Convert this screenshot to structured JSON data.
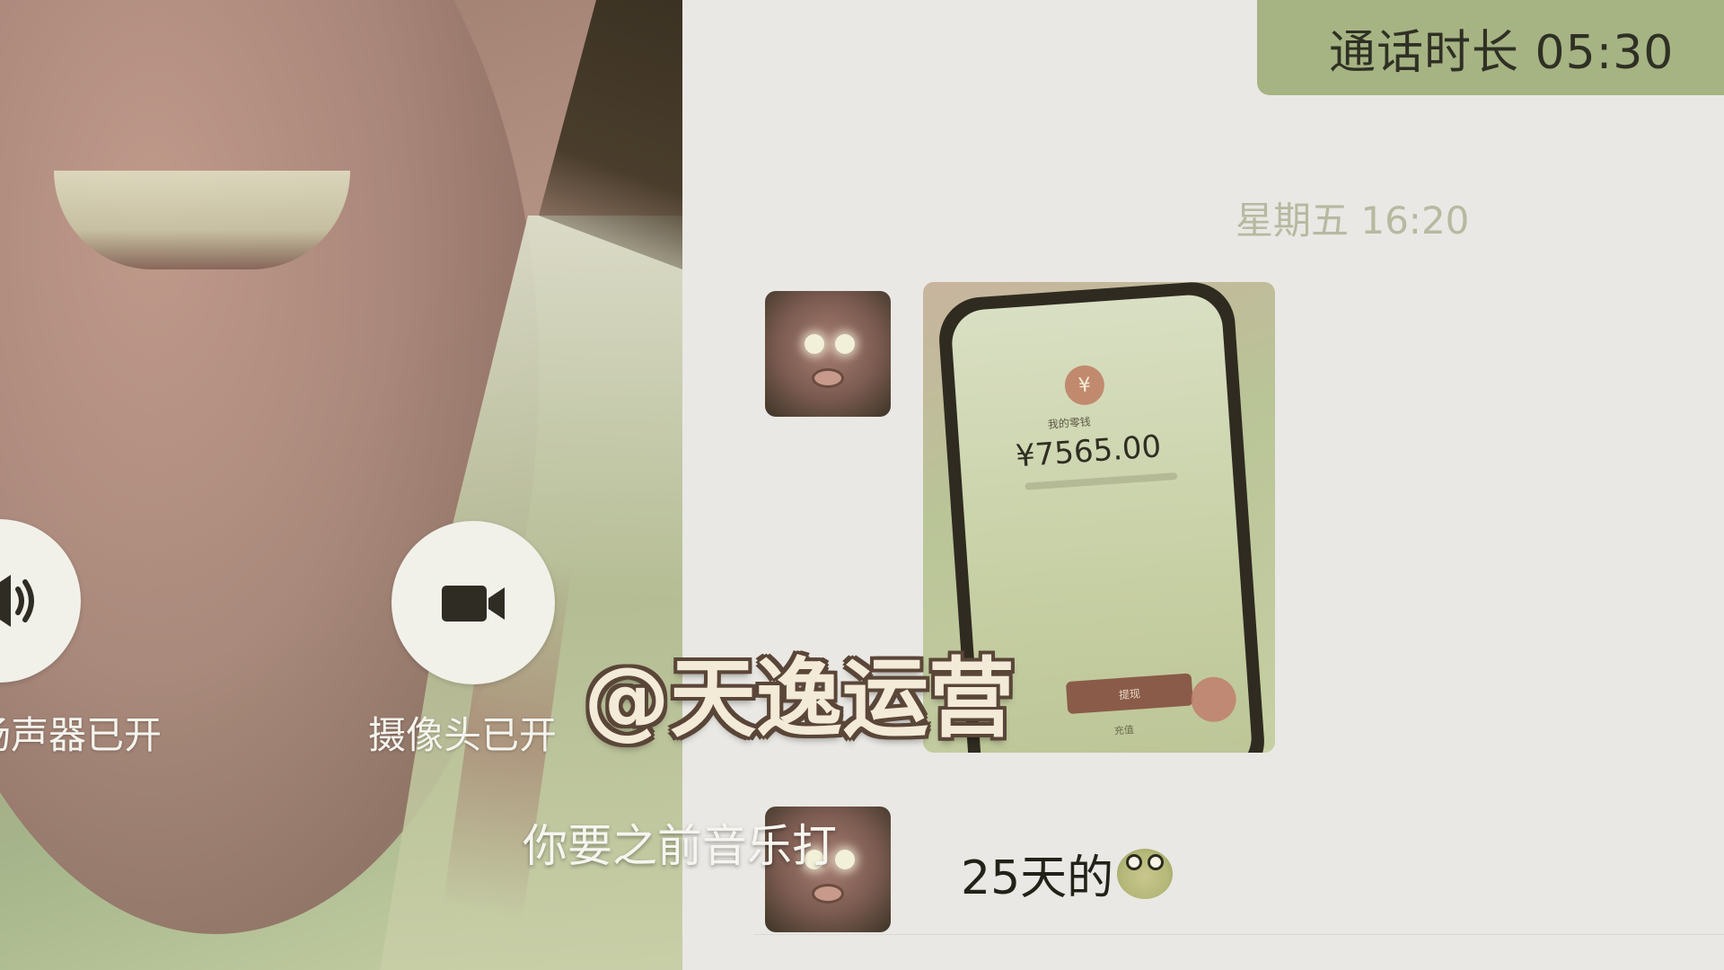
{
  "call": {
    "speaker_label": "扬声器已开",
    "camera_label": "摄像头已开",
    "subtitle": "你要之前音乐打"
  },
  "chat": {
    "call_duration": "通话时长 05:30",
    "timestamp": "星期五 16:20",
    "image_message": {
      "amount": "¥7565.00",
      "balance_label": "我的零钱",
      "button_label": "提现",
      "sub_label": "充值"
    },
    "text_message": "25天的"
  },
  "watermark": "@天逸运营",
  "icons": {
    "speaker": "speaker-icon",
    "camera": "video-camera-icon",
    "call": "phone-call-icon",
    "emoji": "frog-emoji-icon"
  },
  "colors": {
    "bubble_green": "#a6b383",
    "chat_bg": "#e9e8e4",
    "button_bg": "#f1f1ea"
  }
}
